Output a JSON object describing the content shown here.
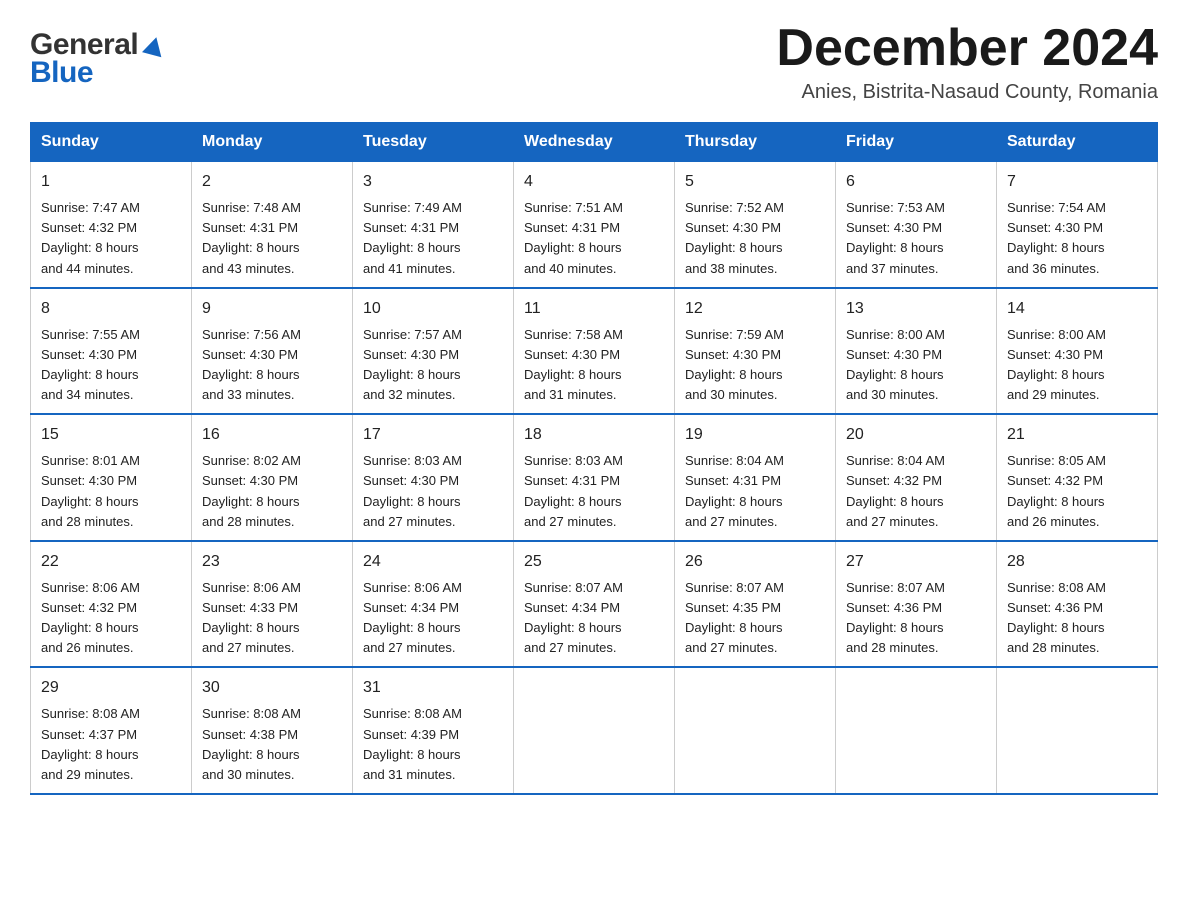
{
  "logo": {
    "general": "General",
    "blue": "Blue"
  },
  "title": {
    "month_year": "December 2024",
    "location": "Anies, Bistrita-Nasaud County, Romania"
  },
  "headers": [
    "Sunday",
    "Monday",
    "Tuesday",
    "Wednesday",
    "Thursday",
    "Friday",
    "Saturday"
  ],
  "weeks": [
    [
      {
        "day": "1",
        "info": "Sunrise: 7:47 AM\nSunset: 4:32 PM\nDaylight: 8 hours\nand 44 minutes."
      },
      {
        "day": "2",
        "info": "Sunrise: 7:48 AM\nSunset: 4:31 PM\nDaylight: 8 hours\nand 43 minutes."
      },
      {
        "day": "3",
        "info": "Sunrise: 7:49 AM\nSunset: 4:31 PM\nDaylight: 8 hours\nand 41 minutes."
      },
      {
        "day": "4",
        "info": "Sunrise: 7:51 AM\nSunset: 4:31 PM\nDaylight: 8 hours\nand 40 minutes."
      },
      {
        "day": "5",
        "info": "Sunrise: 7:52 AM\nSunset: 4:30 PM\nDaylight: 8 hours\nand 38 minutes."
      },
      {
        "day": "6",
        "info": "Sunrise: 7:53 AM\nSunset: 4:30 PM\nDaylight: 8 hours\nand 37 minutes."
      },
      {
        "day": "7",
        "info": "Sunrise: 7:54 AM\nSunset: 4:30 PM\nDaylight: 8 hours\nand 36 minutes."
      }
    ],
    [
      {
        "day": "8",
        "info": "Sunrise: 7:55 AM\nSunset: 4:30 PM\nDaylight: 8 hours\nand 34 minutes."
      },
      {
        "day": "9",
        "info": "Sunrise: 7:56 AM\nSunset: 4:30 PM\nDaylight: 8 hours\nand 33 minutes."
      },
      {
        "day": "10",
        "info": "Sunrise: 7:57 AM\nSunset: 4:30 PM\nDaylight: 8 hours\nand 32 minutes."
      },
      {
        "day": "11",
        "info": "Sunrise: 7:58 AM\nSunset: 4:30 PM\nDaylight: 8 hours\nand 31 minutes."
      },
      {
        "day": "12",
        "info": "Sunrise: 7:59 AM\nSunset: 4:30 PM\nDaylight: 8 hours\nand 30 minutes."
      },
      {
        "day": "13",
        "info": "Sunrise: 8:00 AM\nSunset: 4:30 PM\nDaylight: 8 hours\nand 30 minutes."
      },
      {
        "day": "14",
        "info": "Sunrise: 8:00 AM\nSunset: 4:30 PM\nDaylight: 8 hours\nand 29 minutes."
      }
    ],
    [
      {
        "day": "15",
        "info": "Sunrise: 8:01 AM\nSunset: 4:30 PM\nDaylight: 8 hours\nand 28 minutes."
      },
      {
        "day": "16",
        "info": "Sunrise: 8:02 AM\nSunset: 4:30 PM\nDaylight: 8 hours\nand 28 minutes."
      },
      {
        "day": "17",
        "info": "Sunrise: 8:03 AM\nSunset: 4:30 PM\nDaylight: 8 hours\nand 27 minutes."
      },
      {
        "day": "18",
        "info": "Sunrise: 8:03 AM\nSunset: 4:31 PM\nDaylight: 8 hours\nand 27 minutes."
      },
      {
        "day": "19",
        "info": "Sunrise: 8:04 AM\nSunset: 4:31 PM\nDaylight: 8 hours\nand 27 minutes."
      },
      {
        "day": "20",
        "info": "Sunrise: 8:04 AM\nSunset: 4:32 PM\nDaylight: 8 hours\nand 27 minutes."
      },
      {
        "day": "21",
        "info": "Sunrise: 8:05 AM\nSunset: 4:32 PM\nDaylight: 8 hours\nand 26 minutes."
      }
    ],
    [
      {
        "day": "22",
        "info": "Sunrise: 8:06 AM\nSunset: 4:32 PM\nDaylight: 8 hours\nand 26 minutes."
      },
      {
        "day": "23",
        "info": "Sunrise: 8:06 AM\nSunset: 4:33 PM\nDaylight: 8 hours\nand 27 minutes."
      },
      {
        "day": "24",
        "info": "Sunrise: 8:06 AM\nSunset: 4:34 PM\nDaylight: 8 hours\nand 27 minutes."
      },
      {
        "day": "25",
        "info": "Sunrise: 8:07 AM\nSunset: 4:34 PM\nDaylight: 8 hours\nand 27 minutes."
      },
      {
        "day": "26",
        "info": "Sunrise: 8:07 AM\nSunset: 4:35 PM\nDaylight: 8 hours\nand 27 minutes."
      },
      {
        "day": "27",
        "info": "Sunrise: 8:07 AM\nSunset: 4:36 PM\nDaylight: 8 hours\nand 28 minutes."
      },
      {
        "day": "28",
        "info": "Sunrise: 8:08 AM\nSunset: 4:36 PM\nDaylight: 8 hours\nand 28 minutes."
      }
    ],
    [
      {
        "day": "29",
        "info": "Sunrise: 8:08 AM\nSunset: 4:37 PM\nDaylight: 8 hours\nand 29 minutes."
      },
      {
        "day": "30",
        "info": "Sunrise: 8:08 AM\nSunset: 4:38 PM\nDaylight: 8 hours\nand 30 minutes."
      },
      {
        "day": "31",
        "info": "Sunrise: 8:08 AM\nSunset: 4:39 PM\nDaylight: 8 hours\nand 31 minutes."
      },
      null,
      null,
      null,
      null
    ]
  ]
}
